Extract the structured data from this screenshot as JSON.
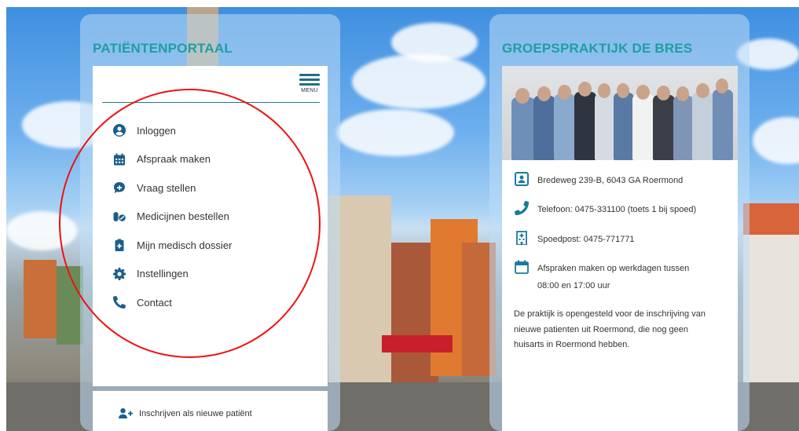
{
  "left_panel": {
    "title": "PATIËNTENPORTAAL",
    "menu_label": "MENU",
    "items": [
      {
        "label": "Inloggen",
        "icon": "user-circle-icon"
      },
      {
        "label": "Afspraak maken",
        "icon": "calendar-icon"
      },
      {
        "label": "Vraag stellen",
        "icon": "chat-icon"
      },
      {
        "label": "Medicijnen bestellen",
        "icon": "pills-icon"
      },
      {
        "label": "Mijn medisch dossier",
        "icon": "medical-file-icon"
      },
      {
        "label": "Instellingen",
        "icon": "gear-icon"
      },
      {
        "label": "Contact",
        "icon": "phone-icon"
      }
    ],
    "enroll_label": "Inschrijven als nieuwe patiënt"
  },
  "right_panel": {
    "title": "GROEPSPRAKTIJK DE BRES",
    "address": "Bredeweg 239-B, 6043 GA Roermond",
    "phone": "Telefoon: 0475-331100 (toets 1 bij spoed)",
    "emergency": "Spoedpost: 0475-771771",
    "appointments_line1": "Afspraken maken op werkdagen tussen",
    "appointments_line2": "08:00 en 17:00 uur",
    "description": "De praktijk is opengesteld voor de inschrijving van nieuwe patienten uit Roermond, die nog geen huisarts in Roermond hebben."
  },
  "colors": {
    "title": "#1f9ea0",
    "icon": "#1a5e8a",
    "annotation": "#e11111"
  }
}
